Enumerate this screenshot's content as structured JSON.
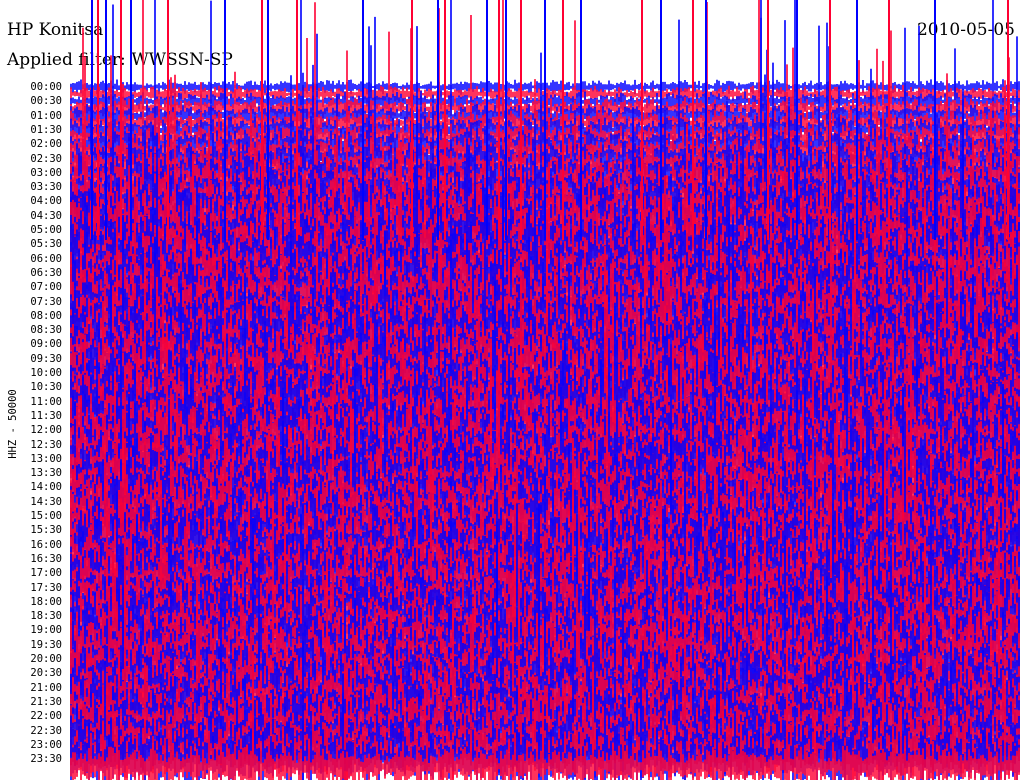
{
  "header": {
    "station": "HP Konitsa",
    "date": "2010-05-05",
    "filter": "Applied filter: WWSSN-SP"
  },
  "chart_data": {
    "type": "line",
    "title": "HP Konitsa",
    "subtitle": "Applied filter: WWSSN-SP",
    "date": "2010-05-05",
    "ylabel": "HHZ - 50000",
    "yticks": [
      "00:00",
      "00:30",
      "01:00",
      "01:30",
      "02:00",
      "02:30",
      "03:00",
      "03:30",
      "04:00",
      "04:30",
      "05:00",
      "05:30",
      "06:00",
      "06:30",
      "07:00",
      "07:30",
      "08:00",
      "08:30",
      "09:00",
      "09:30",
      "10:00",
      "10:30",
      "11:00",
      "11:30",
      "12:00",
      "12:30",
      "13:00",
      "13:30",
      "14:00",
      "14:30",
      "15:00",
      "15:30",
      "16:00",
      "16:30",
      "17:00",
      "17:30",
      "18:00",
      "18:30",
      "19:00",
      "19:30",
      "20:00",
      "20:30",
      "21:00",
      "21:30",
      "22:00",
      "22:30",
      "23:00",
      "23:30"
    ],
    "series_colors": [
      "#0000ff",
      "#ff0033"
    ],
    "trace_duration_minutes": 15,
    "grid": false
  }
}
